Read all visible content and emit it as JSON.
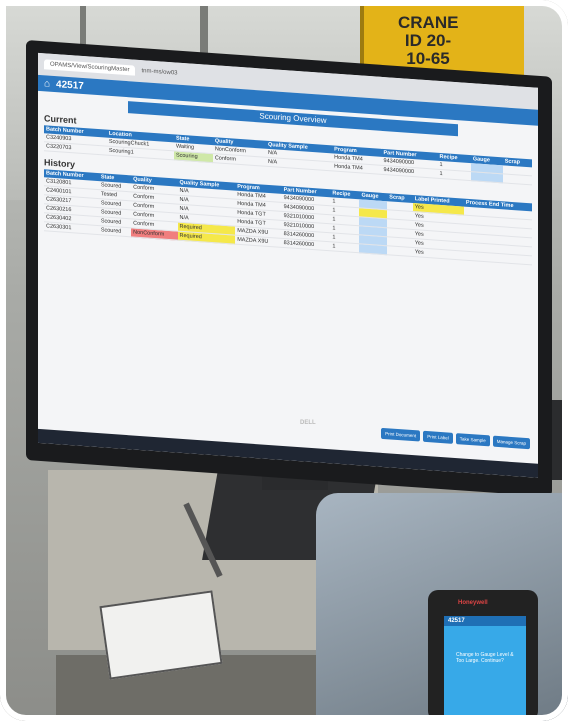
{
  "signs": {
    "crane_id": "CRANE ID 20-10-65"
  },
  "browser": {
    "tab_title": "OPAMS/View/ScouringMaster",
    "address": "tnm-ms/ow03"
  },
  "app": {
    "title": "42517",
    "page_title": "Scouring Overview"
  },
  "current": {
    "heading": "Current",
    "columns": [
      "Batch Number",
      "Location",
      "State",
      "Quality",
      "Quality Sample",
      "Program",
      "Part Number",
      "Recipe",
      "Gauge",
      "Scrap"
    ],
    "rows": [
      [
        "C3240903",
        "ScouringChuck1",
        "Waiting",
        "NonConform",
        "N/A",
        "Honda TM4",
        "9434090000",
        "1",
        "",
        ""
      ],
      [
        "C3220703",
        "Scouring1",
        "Scouring",
        "Conform",
        "N/A",
        "Honda TM4",
        "9434090000",
        "1",
        "",
        ""
      ]
    ]
  },
  "history": {
    "heading": "History",
    "columns": [
      "Batch Number",
      "State",
      "Quality",
      "Quality Sample",
      "Program",
      "Part Number",
      "Recipe",
      "Gauge",
      "Scrap",
      "Label Printed",
      "Process End Time"
    ],
    "rows": [
      [
        "C3120801",
        "Scoured",
        "Conform",
        "N/A",
        "Honda TM4",
        "9434090000",
        "1",
        "",
        "",
        "Yes",
        ""
      ],
      [
        "C2400101",
        "Tested",
        "Conform",
        "N/A",
        "Honda TM4",
        "9434090000",
        "1",
        "",
        "",
        "Yes",
        ""
      ],
      [
        "C2630217",
        "Scoured",
        "Conform",
        "N/A",
        "Honda TGT",
        "9321010000",
        "1",
        "",
        "",
        "Yes",
        ""
      ],
      [
        "C2630216",
        "Scoured",
        "Conform",
        "N/A",
        "Honda TGT",
        "9321010000",
        "1",
        "",
        "",
        "Yes",
        ""
      ],
      [
        "C2630402",
        "Scoured",
        "Conform",
        "Required",
        "MAZDA X9U",
        "8314260000",
        "1",
        "",
        "",
        "Yes",
        ""
      ],
      [
        "C2630301",
        "Scoured",
        "NonConform",
        "Required",
        "MAZDA X9U",
        "8314260000",
        "1",
        "",
        "",
        "Yes",
        ""
      ]
    ]
  },
  "buttons": [
    "Print Document",
    "Print Label",
    "Take Sample",
    "Manage Scrap"
  ],
  "monitor_brand": "DELL",
  "handheld": {
    "brand": "Honeywell",
    "title": "42517",
    "message": "Change to Gauge Level & Too Large. Continue?"
  },
  "colors": {
    "accent": "#2b78c2",
    "highlight_green": "#cfe8a8",
    "highlight_yellow": "#f5e84a",
    "highlight_red": "#f07e7e",
    "crane_yellow": "#e3b318"
  }
}
